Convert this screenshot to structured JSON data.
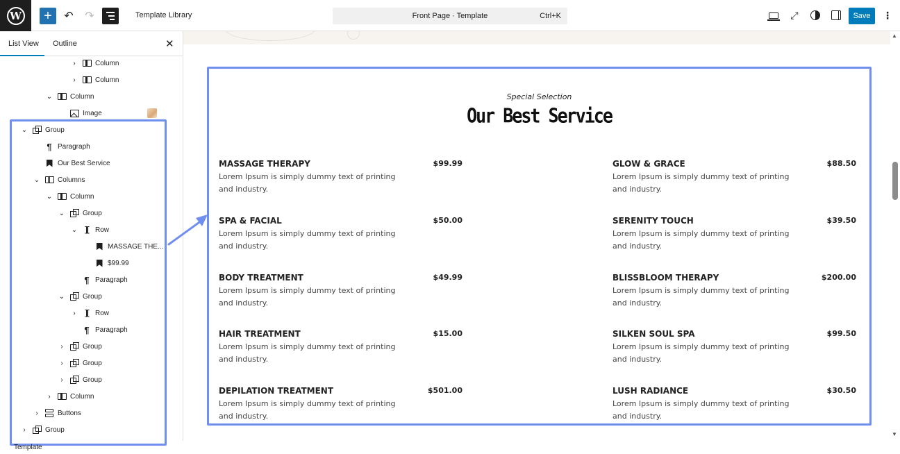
{
  "topbar": {
    "logo_letter": "W",
    "add_label": "+",
    "undo_label": "↶",
    "redo_label": "↷",
    "template_library": "Template Library",
    "command_title": "Front Page · Template",
    "command_shortcut": "Ctrl+K",
    "external_label": "⤢",
    "save_label": "Save",
    "more_label": "⋮"
  },
  "panel": {
    "tab_list_view": "List View",
    "tab_outline": "Outline",
    "close_label": "✕",
    "tree": [
      {
        "label": "Column",
        "chevron": "›",
        "icon": "column"
      },
      {
        "label": "Column",
        "chevron": "›",
        "icon": "column"
      },
      {
        "label": "Column",
        "chevron": "⌄",
        "icon": "column"
      },
      {
        "label": "Image",
        "chevron": "",
        "icon": "image"
      },
      {
        "label": "Group",
        "chevron": "⌄",
        "icon": "group"
      },
      {
        "label": "Paragraph",
        "chevron": "",
        "icon": "paragraph"
      },
      {
        "label": "Our Best Service",
        "chevron": "",
        "icon": "bookmark"
      },
      {
        "label": "Columns",
        "chevron": "⌄",
        "icon": "columns"
      },
      {
        "label": "Column",
        "chevron": "⌄",
        "icon": "column"
      },
      {
        "label": "Group",
        "chevron": "⌄",
        "icon": "group"
      },
      {
        "label": "Row",
        "chevron": "⌄",
        "icon": "row"
      },
      {
        "label": "MASSAGE THE...",
        "chevron": "",
        "icon": "bookmark"
      },
      {
        "label": "$99.99",
        "chevron": "",
        "icon": "bookmark"
      },
      {
        "label": "Paragraph",
        "chevron": "",
        "icon": "paragraph"
      },
      {
        "label": "Group",
        "chevron": "⌄",
        "icon": "group"
      },
      {
        "label": "Row",
        "chevron": "›",
        "icon": "row"
      },
      {
        "label": "Paragraph",
        "chevron": "",
        "icon": "paragraph"
      },
      {
        "label": "Group",
        "chevron": "›",
        "icon": "group"
      },
      {
        "label": "Group",
        "chevron": "›",
        "icon": "group"
      },
      {
        "label": "Group",
        "chevron": "›",
        "icon": "group"
      },
      {
        "label": "Column",
        "chevron": "›",
        "icon": "column"
      },
      {
        "label": "Buttons",
        "chevron": "›",
        "icon": "buttons"
      },
      {
        "label": "Group",
        "chevron": "›",
        "icon": "group"
      }
    ],
    "breadcrumb": "Template"
  },
  "canvas": {
    "eyebrow": "Special Selection",
    "heading": "Our Best Service",
    "services_left": [
      {
        "name": "MASSAGE THERAPY",
        "price": "$99.99",
        "desc": "Lorem Ipsum is simply dummy text of printing and industry."
      },
      {
        "name": "SPA & FACIAL",
        "price": "$50.00",
        "desc": "Lorem Ipsum is simply dummy text of printing and industry."
      },
      {
        "name": "BODY TREATMENT",
        "price": "$49.99",
        "desc": "Lorem Ipsum is simply dummy text of printing and industry."
      },
      {
        "name": "HAIR TREATMENT",
        "price": "$15.00",
        "desc": "Lorem Ipsum is simply dummy text of printing and industry."
      },
      {
        "name": "DEPILATION TREATMENT",
        "price": "$501.00",
        "desc": "Lorem Ipsum is simply dummy text of printing and industry."
      }
    ],
    "services_right": [
      {
        "name": "GLOW & GRACE",
        "price": "$88.50",
        "desc": "Lorem Ipsum is simply dummy text of printing and industry."
      },
      {
        "name": "SERENITY TOUCH",
        "price": "$39.50",
        "desc": "Lorem Ipsum is simply dummy text of printing and industry."
      },
      {
        "name": "BLISSBLOOM THERAPY",
        "price": "$200.00",
        "desc": "Lorem Ipsum is simply dummy text of printing and industry."
      },
      {
        "name": "SILKEN SOUL SPA",
        "price": "$99.50",
        "desc": "Lorem Ipsum is simply dummy text of printing and industry."
      },
      {
        "name": "LUSH RADIANCE",
        "price": "$30.50",
        "desc": "Lorem Ipsum is simply dummy text of printing and industry."
      }
    ]
  },
  "colors": {
    "accent": "#007cba",
    "highlight": "#6f8ef0",
    "topbar_dark": "#1e1e1e"
  }
}
